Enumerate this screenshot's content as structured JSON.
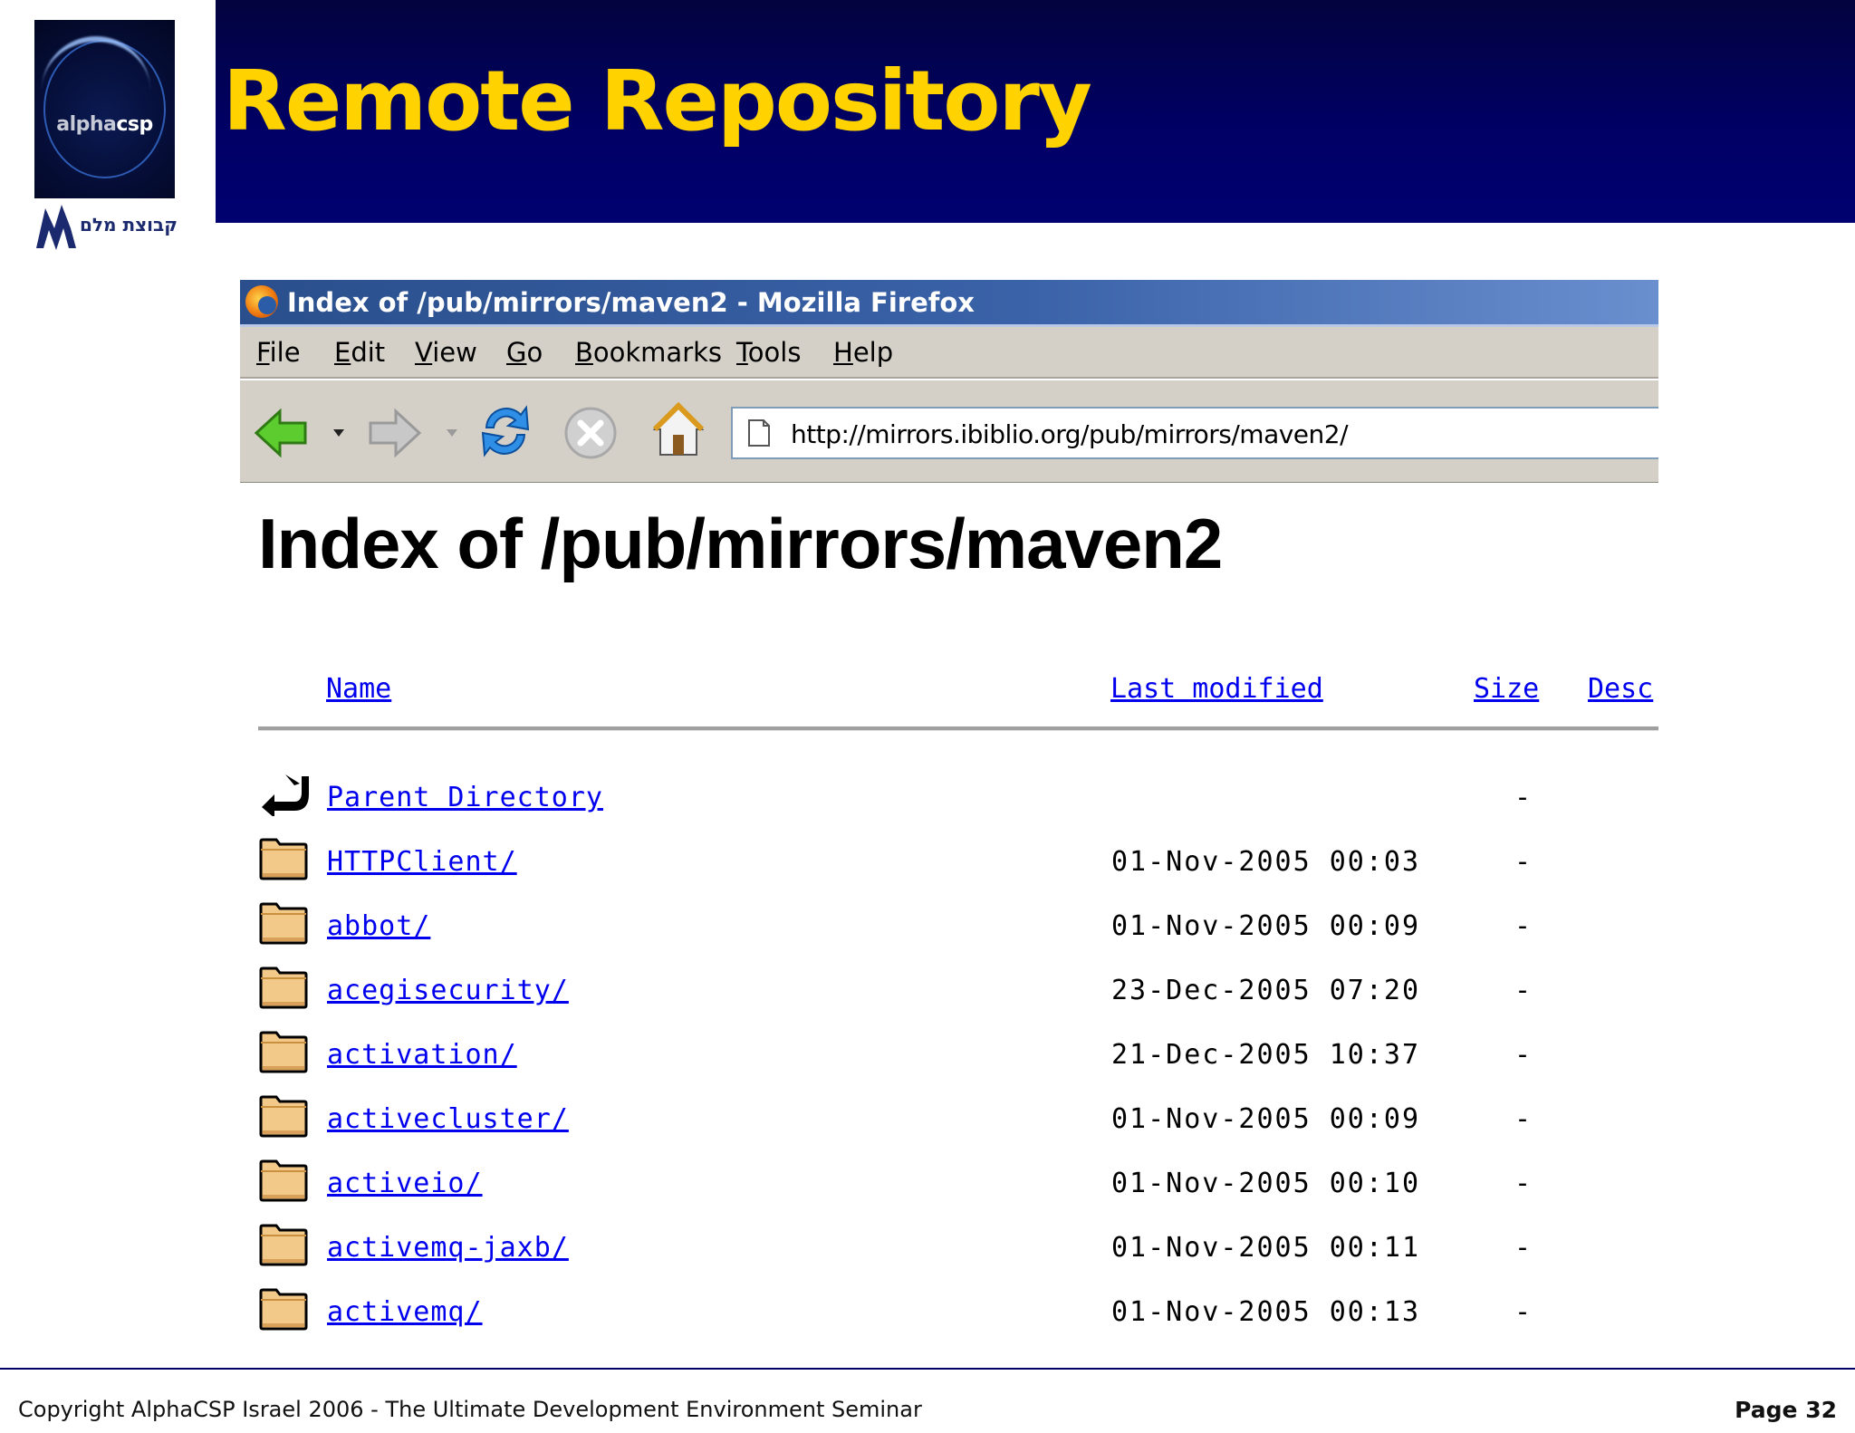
{
  "slide": {
    "title": "Remote Repository",
    "logo_text_1": "alpha",
    "logo_text_2": "csp",
    "malam_text": "קבוצת מלם",
    "copyright": "Copyright AlphaCSP Israel 2006 - The Ultimate Development Environment Seminar",
    "page_number": "Page 32"
  },
  "colors": {
    "title_band": "#000066",
    "title_text": "#ffd200",
    "link": "#0000ee",
    "chrome": "#d4d0c8"
  },
  "browser": {
    "window_title": "Index of /pub/mirrors/maven2 - Mozilla Firefox",
    "menu": [
      {
        "accel": "F",
        "rest": "ile"
      },
      {
        "accel": "E",
        "rest": "dit"
      },
      {
        "accel": "V",
        "rest": "iew"
      },
      {
        "accel": "G",
        "rest": "o"
      },
      {
        "accel": "B",
        "rest": "ookmarks"
      },
      {
        "accel": "T",
        "rest": "ools"
      },
      {
        "accel": "H",
        "rest": "elp"
      }
    ],
    "toolbar_icons": [
      "back-icon",
      "back-dropdown-icon",
      "forward-icon",
      "forward-dropdown-icon",
      "reload-icon",
      "stop-icon",
      "home-icon"
    ],
    "url": "http://mirrors.ibiblio.org/pub/mirrors/maven2/"
  },
  "page": {
    "heading": "Index of /pub/mirrors/maven2",
    "columns": {
      "name": "Name",
      "last_modified": "Last modified",
      "size": "Size",
      "description": "Desc"
    },
    "rows": [
      {
        "icon": "parent-directory-icon",
        "name": "Parent Directory",
        "modified": "",
        "size": "-"
      },
      {
        "icon": "folder-icon",
        "name": "HTTPClient/",
        "modified": "01-Nov-2005 00:03",
        "size": "-"
      },
      {
        "icon": "folder-icon",
        "name": "abbot/",
        "modified": "01-Nov-2005 00:09",
        "size": "-"
      },
      {
        "icon": "folder-icon",
        "name": "acegisecurity/",
        "modified": "23-Dec-2005 07:20",
        "size": "-"
      },
      {
        "icon": "folder-icon",
        "name": "activation/",
        "modified": "21-Dec-2005 10:37",
        "size": "-"
      },
      {
        "icon": "folder-icon",
        "name": "activecluster/",
        "modified": "01-Nov-2005 00:09",
        "size": "-"
      },
      {
        "icon": "folder-icon",
        "name": "activeio/",
        "modified": "01-Nov-2005 00:10",
        "size": "-"
      },
      {
        "icon": "folder-icon",
        "name": "activemq-jaxb/",
        "modified": "01-Nov-2005 00:11",
        "size": "-"
      },
      {
        "icon": "folder-icon",
        "name": "activemq/",
        "modified": "01-Nov-2005 00:13",
        "size": "-"
      }
    ]
  }
}
